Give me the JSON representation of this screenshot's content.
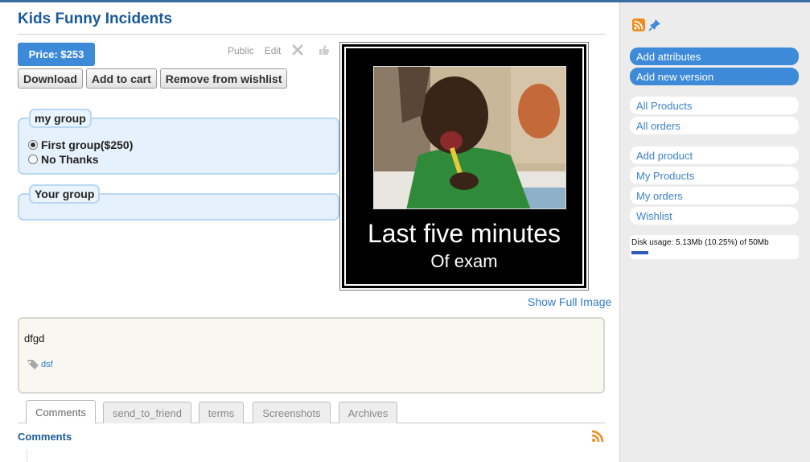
{
  "product": {
    "title": "Kids Funny Incidents",
    "price_label": "Price: $253",
    "meta_public": "Public",
    "meta_edit": "Edit"
  },
  "actions": {
    "download": "Download",
    "add_to_cart": "Add to cart",
    "remove_from_wishlist": "Remove from wishlist"
  },
  "groups": {
    "my_group": {
      "legend": "my group",
      "options": [
        {
          "label": "First group($250)",
          "selected": true
        },
        {
          "label": "No Thanks",
          "selected": false
        }
      ]
    },
    "your_group": {
      "legend": "Your group"
    }
  },
  "image": {
    "caption_line1": "Last five minutes",
    "caption_line2": "Of exam",
    "show_full_link": "Show Full Image"
  },
  "description": {
    "text": "dfgd",
    "tag": "dsf"
  },
  "tabs": [
    {
      "label": "Comments",
      "active": true
    },
    {
      "label": "send_to_friend",
      "active": false
    },
    {
      "label": "terms",
      "active": false
    },
    {
      "label": "Screenshots",
      "active": false
    },
    {
      "label": "Archives",
      "active": false
    }
  ],
  "comments": {
    "heading": "Comments"
  },
  "sidebar": {
    "action_buttons": [
      "Add attributes",
      "Add new version"
    ],
    "nav_group1": [
      "All Products",
      "All orders"
    ],
    "nav_group2": [
      "Add product",
      "My Products",
      "My orders",
      "Wishlist"
    ],
    "disk_usage": {
      "text": "Disk usage: 5.13Mb (10.25%) of 50Mb",
      "fraction": 0.1025
    }
  },
  "colors": {
    "accent_blue": "#3d8ad8",
    "title_blue": "#1a5a9a",
    "link_blue": "#2f7ec8",
    "group_bg": "#e5f1fc",
    "rss_orange": "#f08a1d"
  },
  "icons": [
    "delete-icon",
    "like-icon",
    "rss-icon",
    "pin-icon",
    "tag-icon"
  ]
}
